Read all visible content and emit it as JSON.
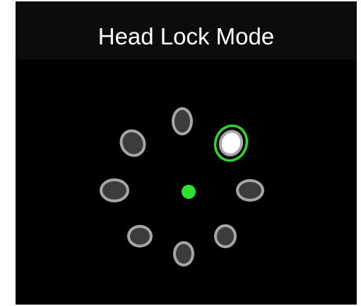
{
  "header": {
    "title": "Head Lock Mode"
  },
  "targets": {
    "count": 8,
    "selected_index": 1,
    "items": [
      {
        "name": "top",
        "state": "idle"
      },
      {
        "name": "top-right",
        "state": "selected"
      },
      {
        "name": "right",
        "state": "idle"
      },
      {
        "name": "bottom-right",
        "state": "idle"
      },
      {
        "name": "bottom",
        "state": "idle"
      },
      {
        "name": "bottom-left",
        "state": "idle"
      },
      {
        "name": "left",
        "state": "idle"
      },
      {
        "name": "top-left",
        "state": "idle"
      }
    ]
  },
  "center_marker": {
    "icon": "center-dot-icon"
  },
  "colors": {
    "background": "#000000",
    "title_bar": "#0c0c0c",
    "title_text": "#ffffff",
    "target_ring": "#a6a6a6",
    "target_fill": "#3c3c3c",
    "selected_fill": "#ffffff",
    "selected_highlight": "#2fd62f",
    "center_dot": "#2fe02f"
  }
}
